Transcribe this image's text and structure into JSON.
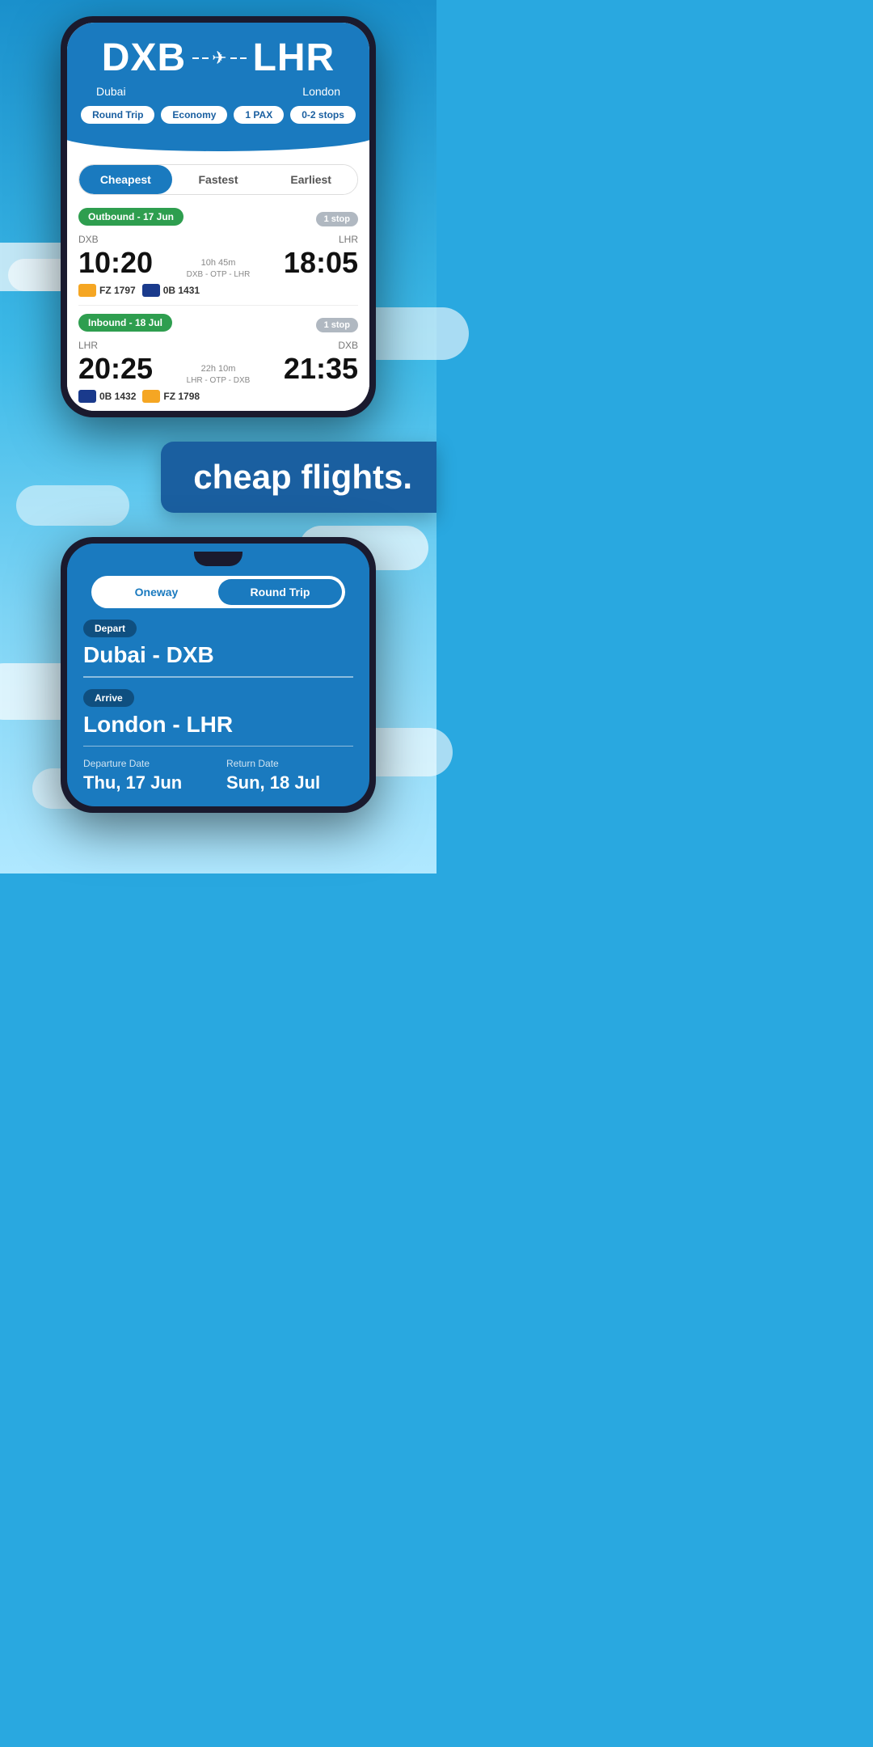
{
  "background": {
    "color": "#29a8e0"
  },
  "phone1": {
    "header": {
      "origin_code": "DXB",
      "destination_code": "LHR",
      "origin_city": "Dubai",
      "destination_city": "London",
      "tags": [
        "Round Trip",
        "Economy",
        "1 PAX",
        "0-2 stops"
      ]
    },
    "filter_tabs": [
      {
        "label": "Cheapest",
        "active": true
      },
      {
        "label": "Fastest",
        "active": false
      },
      {
        "label": "Earliest",
        "active": false
      }
    ],
    "outbound": {
      "label": "Outbound - 17 Jun",
      "stop_label": "1 stop",
      "origin": "DXB",
      "destination": "LHR",
      "depart_time": "10:20",
      "arrive_time": "18:05",
      "duration": "10h 45m",
      "route": "DXB - OTP - LHR",
      "airlines": [
        {
          "code": "FZ 1797",
          "color": "orange"
        },
        {
          "code": "0B 1431",
          "color": "blue"
        }
      ]
    },
    "inbound": {
      "label": "Inbound - 18 Jul",
      "stop_label": "1 stop",
      "origin": "LHR",
      "destination": "DXB",
      "depart_time": "20:25",
      "arrive_time": "21:35",
      "duration": "22h 10m",
      "route": "LHR - OTP - DXB",
      "airlines": [
        {
          "code": "0B 1432",
          "color": "blue"
        },
        {
          "code": "FZ 1798",
          "color": "orange"
        }
      ]
    }
  },
  "banner": {
    "text": "cheap flights."
  },
  "phone2": {
    "trip_options": [
      {
        "label": "Oneway",
        "active": false
      },
      {
        "label": "Round Trip",
        "active": true
      }
    ],
    "depart_label": "Depart",
    "depart_value": "Dubai - DXB",
    "arrive_label": "Arrive",
    "arrive_value": "London - LHR",
    "departure_date_label": "Departure Date",
    "departure_date_value": "Thu, 17 Jun",
    "return_date_label": "Return Date",
    "return_date_value": "Sun, 18 Jul"
  }
}
